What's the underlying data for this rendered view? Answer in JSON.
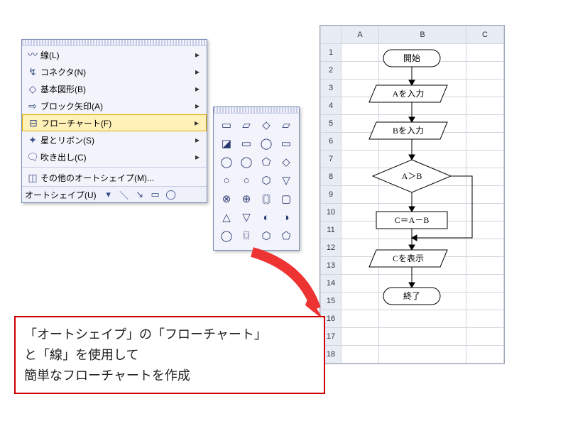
{
  "menu": {
    "items": [
      {
        "icon": "〰",
        "label": "線(L)"
      },
      {
        "icon": "↯",
        "label": "コネクタ(N)"
      },
      {
        "icon": "◇",
        "label": "基本図形(B)"
      },
      {
        "icon": "⇨",
        "label": "ブロック矢印(A)"
      },
      {
        "icon": "⊟",
        "label": "フローチャート(F)"
      },
      {
        "icon": "✦",
        "label": "星とリボン(S)"
      },
      {
        "icon": "🗨",
        "label": "吹き出し(C)"
      },
      {
        "icon": "◫",
        "label": "その他のオートシェイプ(M)..."
      }
    ],
    "toolbar_label": "オートシェイプ(U)"
  },
  "palette": {
    "shapes": [
      "▭",
      "▱",
      "◇",
      "▱",
      "◪",
      "▭",
      "◯",
      "▭",
      "◯",
      "◯",
      "⬠",
      "◇",
      "○",
      "○",
      "⬡",
      "▽",
      "⊗",
      "⊕",
      "〘〙",
      "▢",
      "△",
      "▽",
      "◐",
      "◑",
      "◯",
      "⌼",
      "⬡",
      "⬠"
    ]
  },
  "sheet": {
    "cols": [
      "A",
      "B",
      "C"
    ],
    "rows": 18
  },
  "flowchart": {
    "start": "開始",
    "input_a": "Aを入力",
    "input_b": "Bを入力",
    "decision": "A＞B",
    "process": "C＝A－B",
    "output": "Cを表示",
    "end": "終了"
  },
  "callout": {
    "line1": "「オートシェイプ」の「フローチャート」",
    "line2": "と「線」を使用して",
    "line3": "簡単なフローチャートを作成"
  }
}
